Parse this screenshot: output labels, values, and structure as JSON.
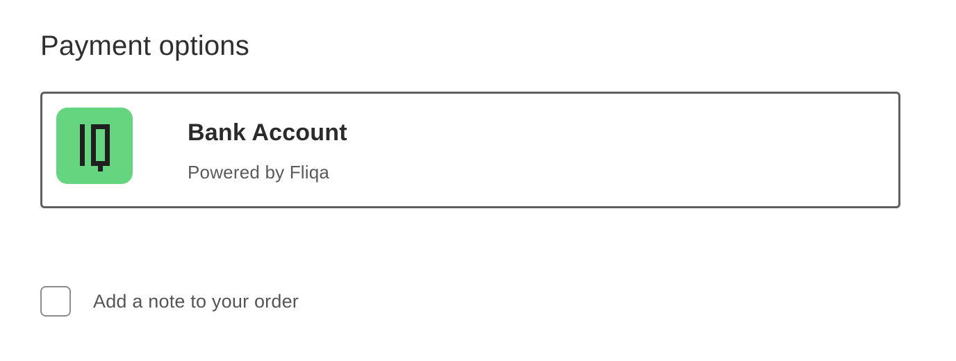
{
  "page": {
    "title": "Payment options"
  },
  "payment_option": {
    "title": "Bank Account",
    "subtitle": "Powered by Fliqa",
    "logo_icon": "fliqa-iq-logo-icon",
    "logo_color": "#66d57f",
    "selected": true
  },
  "note": {
    "label": "Add a note to your order",
    "checked": false
  }
}
